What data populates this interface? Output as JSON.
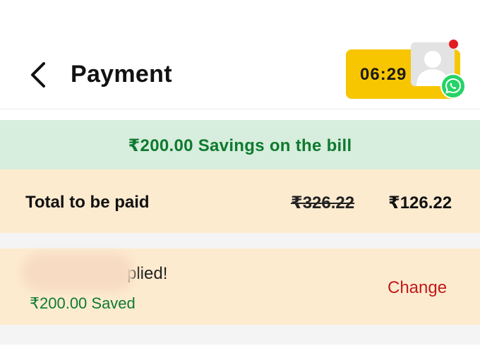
{
  "header": {
    "title": "Payment",
    "back_icon": "chevron-left-icon",
    "timer": "06:29",
    "avatar_icon": "user-avatar-icon",
    "chat_icon": "whatsapp-icon"
  },
  "savings_banner": {
    "text": "₹200.00 Savings on the bill"
  },
  "total": {
    "label": "Total to be paid",
    "original_amount": "₹326.22",
    "final_amount": "₹126.22"
  },
  "coupon": {
    "applied_text": "plied!",
    "saved_text": "₹200.00 Saved",
    "change_label": "Change"
  },
  "colors": {
    "brand_yellow": "#f7c600",
    "savings_green": "#0e7a2e",
    "savings_bg": "#d7eddd",
    "card_bg": "#fdebd0",
    "change_red": "#c11a1a",
    "whatsapp_green": "#25d366",
    "notification_red": "#e31b23"
  }
}
